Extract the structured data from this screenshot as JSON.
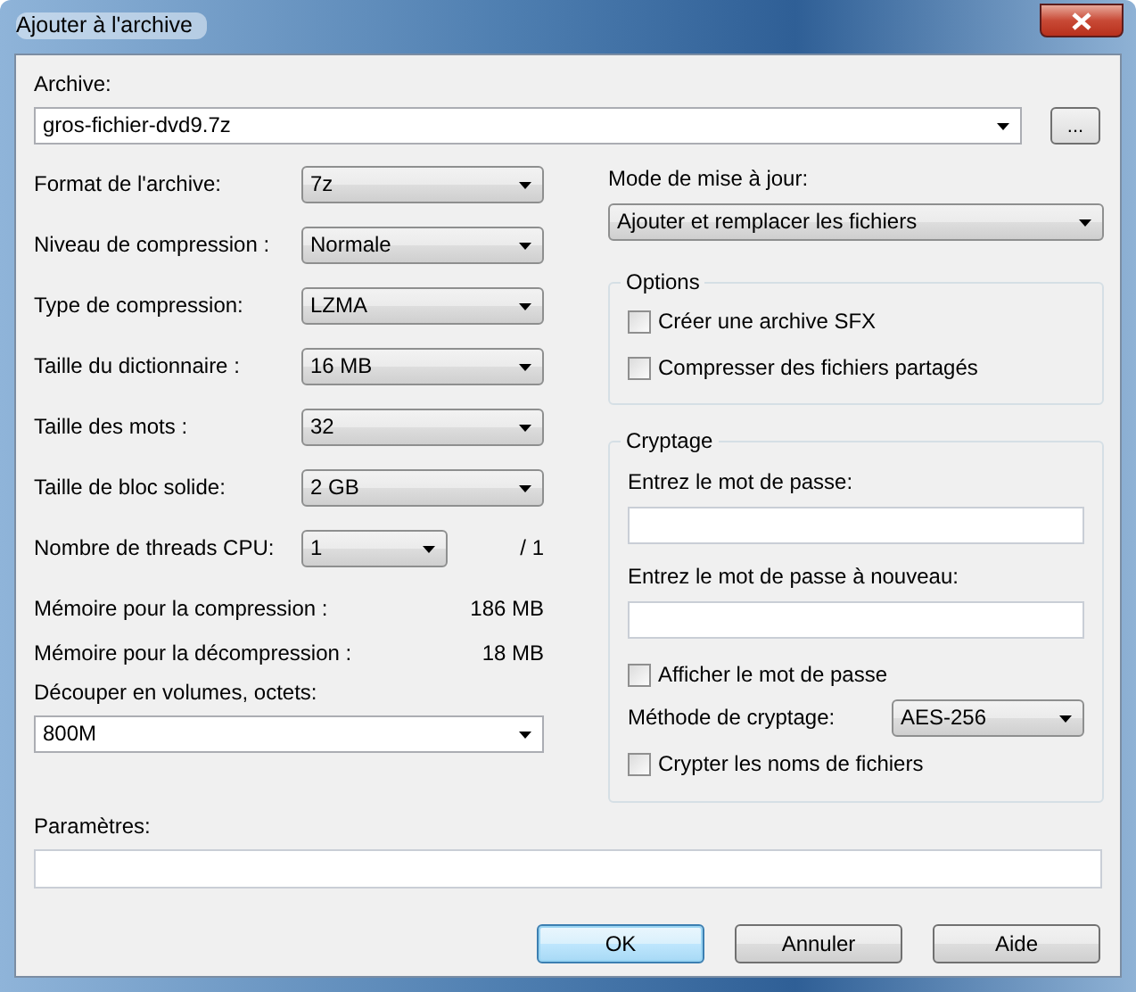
{
  "window": {
    "title": "Ajouter à l'archive"
  },
  "archive": {
    "label": "Archive:",
    "value": "gros-fichier-dvd9.7z",
    "browse_button": "..."
  },
  "settings": [
    {
      "kind": "combo",
      "label": "Format de l'archive:",
      "value": "7z"
    },
    {
      "kind": "combo",
      "label": "Niveau de compression :",
      "value": "Normale"
    },
    {
      "kind": "combo",
      "label": "Type de compression:",
      "value": "LZMA"
    },
    {
      "kind": "combo",
      "label": "Taille du dictionnaire :",
      "value": "16 MB"
    },
    {
      "kind": "combo",
      "label": "Taille des mots :",
      "value": "32"
    },
    {
      "kind": "combo",
      "label": "Taille de bloc solide:",
      "value": "2 GB"
    },
    {
      "kind": "threads",
      "label": "Nombre de threads CPU:",
      "value": "1",
      "suffix": "/ 1"
    },
    {
      "kind": "info",
      "label": "Mémoire pour la compression :",
      "value": "186 MB"
    },
    {
      "kind": "info",
      "label": "Mémoire pour la décompression :",
      "value": "18 MB"
    }
  ],
  "split": {
    "label": "Découper en volumes, octets:",
    "value": "800M"
  },
  "update_mode": {
    "label": "Mode de mise à jour:",
    "value": "Ajouter et remplacer les fichiers"
  },
  "options": {
    "title": "Options",
    "items": [
      {
        "label": "Créer une archive SFX",
        "checked": false
      },
      {
        "label": "Compresser des fichiers partagés",
        "checked": false
      }
    ]
  },
  "encryption": {
    "title": "Cryptage",
    "password_label": "Entrez le mot de passe:",
    "password2_label": "Entrez le mot de passe à nouveau:",
    "show_password": {
      "label": "Afficher le mot de passe",
      "checked": false
    },
    "method_label": "Méthode de cryptage:",
    "method": "AES-256",
    "encrypt_names": {
      "label": "Crypter les noms de fichiers",
      "checked": false
    }
  },
  "parameters": {
    "label": "Paramètres:"
  },
  "buttons": [
    {
      "label": "OK",
      "default": true
    },
    {
      "label": "Annuler",
      "default": false
    },
    {
      "label": "Aide",
      "default": false
    }
  ]
}
